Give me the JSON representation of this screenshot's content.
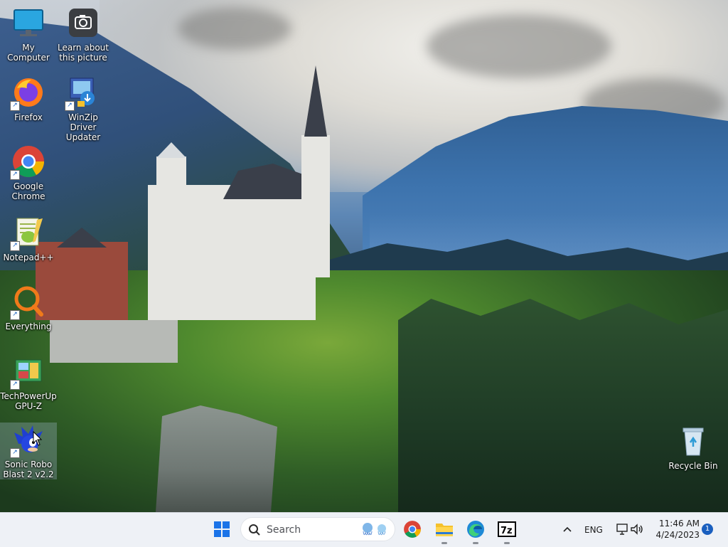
{
  "desktop": {
    "icons": [
      {
        "label": "My Computer"
      },
      {
        "label": "Learn about this picture"
      },
      {
        "label": "Firefox"
      },
      {
        "label": "WinZip Driver Updater"
      },
      {
        "label": "Google Chrome"
      },
      {
        "label": "Notepad++"
      },
      {
        "label": "Everything"
      },
      {
        "label": "TechPowerUp GPU-Z"
      },
      {
        "label": "Sonic Robo Blast 2 v2.2"
      },
      {
        "label": "Recycle Bin"
      }
    ]
  },
  "taskbar": {
    "search_label": "Search",
    "language": "ENG",
    "time": "11:46 AM",
    "date": "4/24/2023",
    "notification_count": "1"
  },
  "colors": {
    "accent": "#1a5fbf",
    "taskbar_bg": "#eef1f6"
  }
}
